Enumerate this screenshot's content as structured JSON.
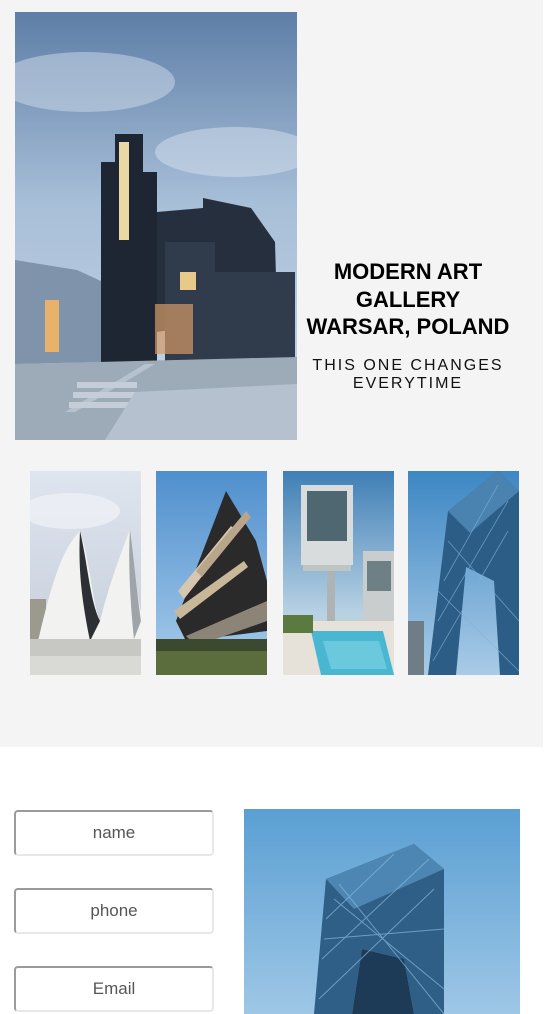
{
  "hero": {
    "title": "MODERN ART GALLERY WARSAR, POLAND",
    "subtitle": "THIS ONE CHANGES EVERYTIME",
    "image": "modern-dark-house-image"
  },
  "gallery": {
    "thumbnails": [
      {
        "image": "white-wave-building-image"
      },
      {
        "image": "angular-dark-building-image"
      },
      {
        "image": "cantilever-house-pool-image"
      },
      {
        "image": "glass-arch-tower-image"
      }
    ]
  },
  "contact_form": {
    "name_placeholder": "name",
    "phone_placeholder": "phone",
    "email_placeholder": "Email"
  },
  "side_image": {
    "image": "glass-arch-tower-image"
  },
  "colors": {
    "background_top": "#f4f4f4",
    "background_bottom": "#ffffff",
    "sky_blue": "#6fa7d4",
    "text": "#000000"
  }
}
